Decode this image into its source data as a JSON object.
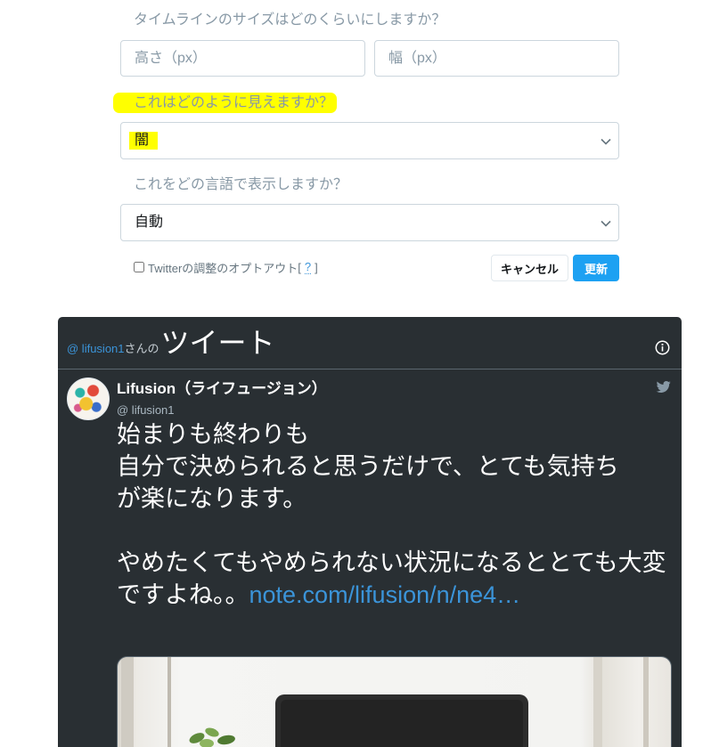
{
  "form": {
    "size_question": "タイムラインのサイズはどのくらいにしますか？",
    "height_placeholder": "高さ（px）",
    "width_placeholder": "幅（px）",
    "theme_question": "これはどのように見えますか？",
    "theme_value": "闇",
    "language_question": "これをどの言語で表示しますか？",
    "language_value": "自動",
    "optout_label": "Twitterの調整のオプトアウト",
    "optout_open": "[",
    "optout_help": "?",
    "optout_close": "]",
    "optout_checked": false,
    "cancel_label": "キャンセル",
    "update_label": "更新"
  },
  "timeline": {
    "header_handle": "@ lifusion1",
    "header_suffix": "さんの",
    "header_title": "ツイート",
    "tweet": {
      "author_name": "Lifusion（ライフュージョン）",
      "author_handle": "@ lifusion1",
      "paragraphs": [
        [
          "始まりも終わりも",
          "自分で決められると思うだけで、とても気持ち",
          "が楽になります。"
        ],
        [
          "やめたくてもやめられない状況になるととても大変",
          "ですよね。。"
        ]
      ],
      "link_text": "note.com/lifusion/n/ne4…"
    }
  },
  "icons": {
    "select_chevron": "chevron-down-icon",
    "info": "info-icon",
    "network": "twitter-bird-icon"
  },
  "colors": {
    "accent": "#1da1f2",
    "highlight": "#ffff00",
    "dark_bg": "#292f33",
    "link": "#3b94d9"
  }
}
